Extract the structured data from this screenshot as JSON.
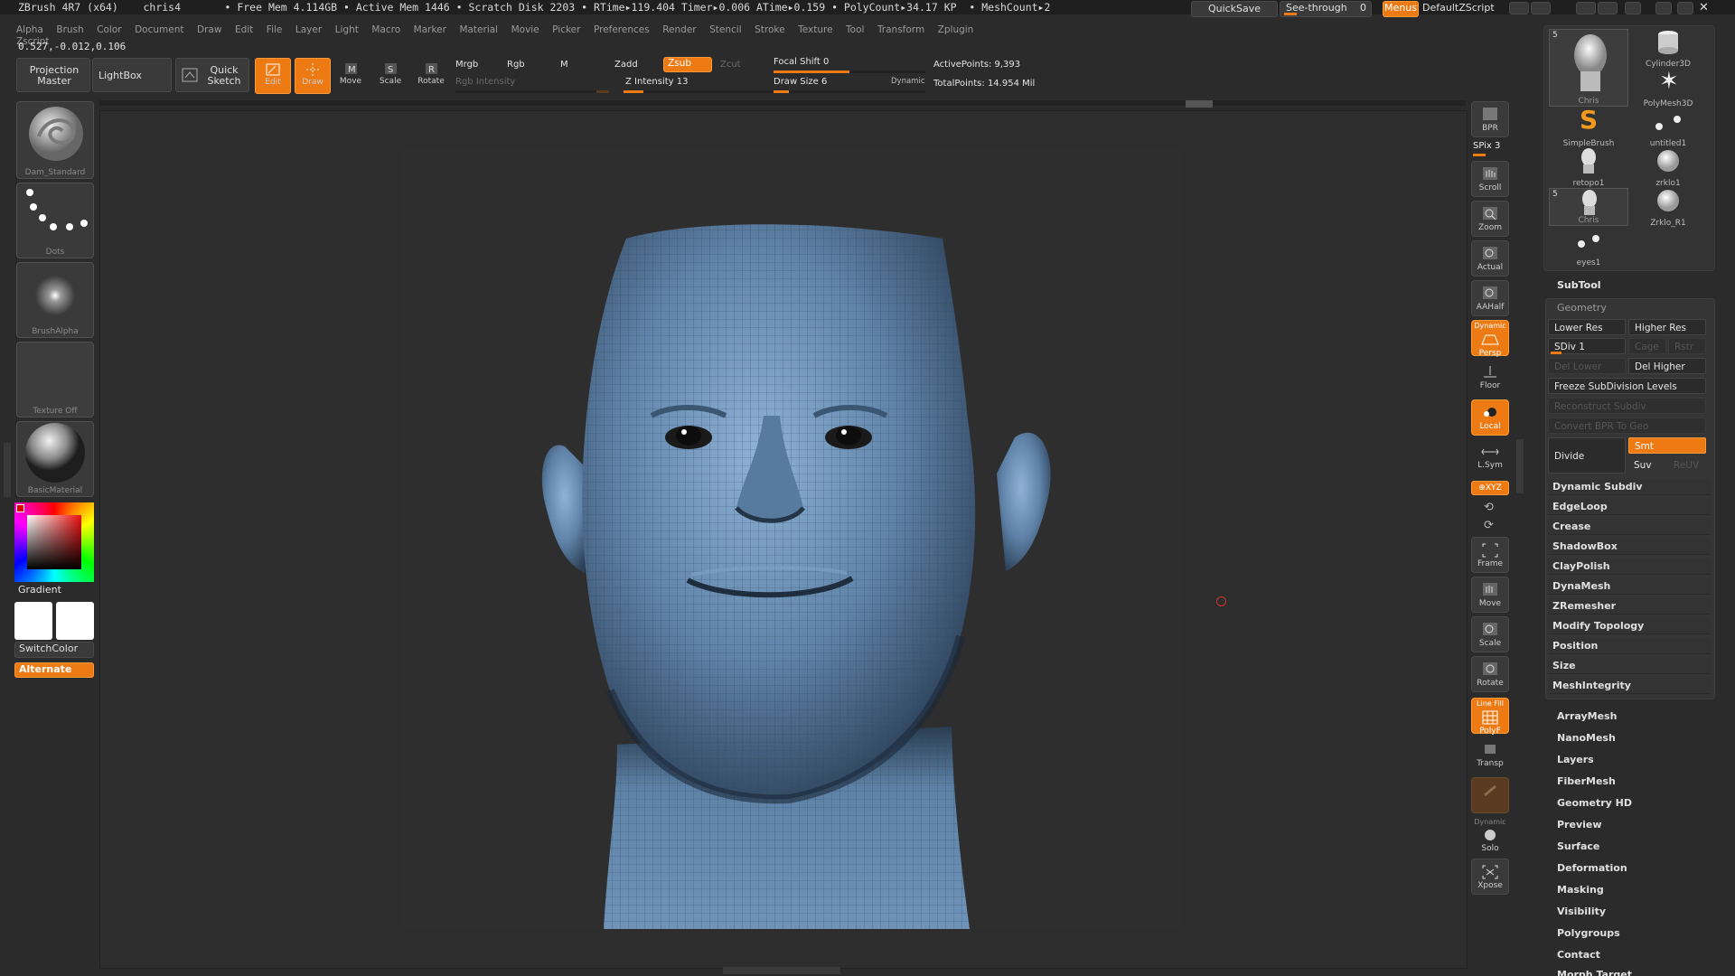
{
  "title_bar": {
    "text": "ZBrush 4R7 (x64)    chris4       • Free Mem 4.114GB • Active Mem 1446 • Scratch Disk 2203 • RTime▸119.404 Timer▸0.006 ATime▸0.159 • PolyCount▸34.17 KP  • MeshCount▸2",
    "quicksave": "QuickSave",
    "see_through_label": "See-through",
    "see_through_value": "0",
    "menus": "Menus",
    "script": "DefaultZScript"
  },
  "menu_bar": [
    "Alpha",
    "Brush",
    "Color",
    "Document",
    "Draw",
    "Edit",
    "File",
    "Layer",
    "Light",
    "Macro",
    "Marker",
    "Material",
    "Movie",
    "Picker",
    "Preferences",
    "Render",
    "Stencil",
    "Stroke",
    "Texture",
    "Tool",
    "Transform",
    "Zplugin",
    "Zscript"
  ],
  "coordinates": "0.527,-0.012,0.106",
  "top_shelf": {
    "projection_master": "Projection Master",
    "lightbox": "LightBox",
    "quick_sketch": "Quick Sketch",
    "edit": "Edit",
    "draw": "Draw",
    "move": "Move",
    "scale": "Scale",
    "rotate": "Rotate",
    "mrgb": "Mrgb",
    "rgb": "Rgb",
    "m": "M",
    "rgb_intensity": "Rgb Intensity",
    "zadd": "Zadd",
    "zsub": "Zsub",
    "zcut": "Zcut",
    "z_intensity": "Z Intensity 13",
    "focal_shift": "Focal Shift 0",
    "draw_size": "Draw Size 6",
    "dynamic": "Dynamic",
    "active_points": "ActivePoints: 9,393",
    "total_points": "TotalPoints: 14.954 Mil",
    "z_intensity_level": 0.13,
    "focal_shift_level": 0.5,
    "draw_size_level": 0.1
  },
  "left_shelf": {
    "brush": "Dam_Standard",
    "stroke": "Dots",
    "alpha": "BrushAlpha",
    "texture": "Texture Off",
    "material": "BasicMaterial",
    "gradient": "Gradient",
    "switch_color": "SwitchColor",
    "alternate": "Alternate"
  },
  "right_shelf": {
    "bpr": "BPR",
    "spix": "SPix 3",
    "scroll": "Scroll",
    "zoom": "Zoom",
    "actual": "Actual",
    "aahalf": "AAHalf",
    "persp_top": "Dynamic",
    "persp": "Persp",
    "floor": "Floor",
    "local": "Local",
    "lsym": "L.Sym",
    "xyz": "⊕XYZ",
    "frame": "Frame",
    "move": "Move",
    "scale": "Scale",
    "rotate": "Rotate",
    "polyf_top": "Line Fill",
    "polyf": "PolyF",
    "transp": "Transp",
    "dynamic": "Dynamic",
    "solo": "Solo",
    "xpose": "Xpose"
  },
  "tool_tray": {
    "items": [
      {
        "label": "Chris",
        "badge": "5"
      },
      {
        "label": "Cylinder3D"
      },
      {
        "label": "PolyMesh3D"
      },
      {
        "label": "SimpleBrush"
      },
      {
        "label": "untitled1"
      },
      {
        "label": "retopo1"
      },
      {
        "label": "zrklo1"
      },
      {
        "label": "Chris",
        "badge": "5"
      },
      {
        "label": "Zrklo_R1"
      },
      {
        "label": "eyes1"
      }
    ]
  },
  "subtool": "SubTool",
  "geometry": {
    "title": "Geometry",
    "lower_res": "Lower Res",
    "higher_res": "Higher Res",
    "sdiv": "SDiv 1",
    "cage": "Cage",
    "rstr": "Rstr",
    "del_lower": "Del Lower",
    "del_higher": "Del Higher",
    "freeze": "Freeze SubDivision Levels",
    "reconstruct": "Reconstruct Subdiv",
    "convert_bpr": "Convert BPR To Geo",
    "divide": "Divide",
    "smt": "Smt",
    "suv": "Suv",
    "reuv": "ReUV",
    "rows": [
      "Dynamic Subdiv",
      "EdgeLoop",
      "Crease",
      "ShadowBox",
      "ClayPolish",
      "DynaMesh",
      "ZRemesher",
      "Modify Topology",
      "Position",
      "Size",
      "MeshIntegrity"
    ]
  },
  "right_list": [
    "ArrayMesh",
    "NanoMesh",
    "Layers",
    "FiberMesh",
    "Geometry HD",
    "Preview",
    "Surface",
    "Deformation",
    "Masking",
    "Visibility",
    "Polygroups",
    "Contact",
    "Morph Target"
  ],
  "colors": {
    "accent": "#ee7a14",
    "mesh": "#6f93b8",
    "bg": "#2b2b2b"
  }
}
